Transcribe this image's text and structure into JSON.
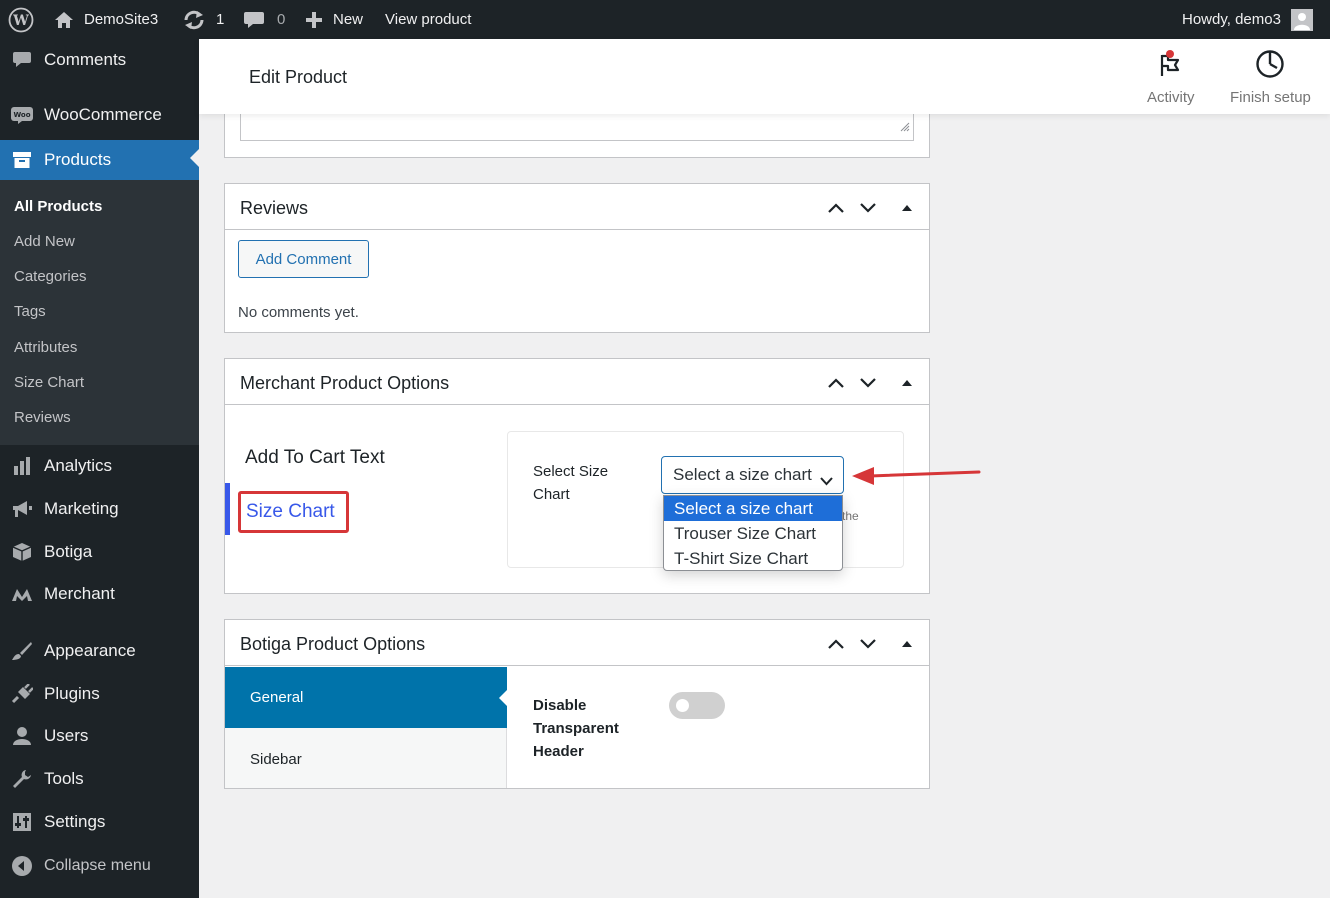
{
  "adminbar": {
    "site_name": "DemoSite3",
    "updates_count": "1",
    "comments_count": "0",
    "new_label": "New",
    "view_product_label": "View product",
    "howdy_label": "Howdy, demo3"
  },
  "sidebar": {
    "comments": "Comments",
    "woocommerce": "WooCommerce",
    "products": "Products",
    "submenu": [
      "All Products",
      "Add New",
      "Categories",
      "Tags",
      "Attributes",
      "Size Chart",
      "Reviews"
    ],
    "analytics": "Analytics",
    "marketing": "Marketing",
    "botiga": "Botiga",
    "merchant": "Merchant",
    "appearance": "Appearance",
    "plugins": "Plugins",
    "users": "Users",
    "tools": "Tools",
    "settings": "Settings",
    "collapse": "Collapse menu"
  },
  "header": {
    "title": "Edit Product",
    "activity_label": "Activity",
    "finish_setup_label": "Finish setup"
  },
  "reviews_box": {
    "title": "Reviews",
    "add_comment_label": "Add Comment",
    "empty_text": "No comments yet."
  },
  "merchant_box": {
    "title": "Merchant Product Options",
    "tab_add_to_cart": "Add To Cart Text",
    "tab_size_chart": "Size Chart",
    "field_label": "Select Size Chart",
    "select_value": "Select a size chart",
    "options": [
      "Select a size chart",
      "Trouser Size Chart",
      "T-Shirt Size Chart"
    ],
    "hint_fragment": "the"
  },
  "botiga_box": {
    "title": "Botiga Product Options",
    "tab_general": "General",
    "tab_sidebar": "Sidebar",
    "field_label": "Disable Transparent Header",
    "toggle_on": false
  },
  "colors": {
    "accent": "#2271b1",
    "admin_dark": "#1d2327",
    "highlight_red": "#d63638",
    "option_selected": "#1e6ed8"
  }
}
